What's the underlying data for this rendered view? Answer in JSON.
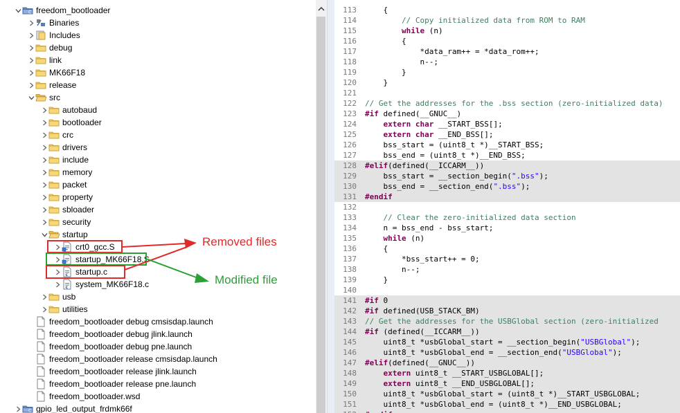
{
  "project_explorer": {
    "items": [
      {
        "label": "freedom_bootloader",
        "icon": "project-folder-icon",
        "indent": 0,
        "twisty": "expanded"
      },
      {
        "label": "Binaries",
        "icon": "binaries-icon",
        "indent": 1,
        "twisty": "collapsed"
      },
      {
        "label": "Includes",
        "icon": "includes-icon",
        "indent": 1,
        "twisty": "collapsed"
      },
      {
        "label": "debug",
        "icon": "folder-icon",
        "indent": 1,
        "twisty": "collapsed"
      },
      {
        "label": "link",
        "icon": "folder-icon",
        "indent": 1,
        "twisty": "collapsed"
      },
      {
        "label": "MK66F18",
        "icon": "folder-icon",
        "indent": 1,
        "twisty": "collapsed"
      },
      {
        "label": "release",
        "icon": "folder-icon",
        "indent": 1,
        "twisty": "collapsed"
      },
      {
        "label": "src",
        "icon": "folder-open-icon",
        "indent": 1,
        "twisty": "expanded"
      },
      {
        "label": "autobaud",
        "icon": "folder-icon",
        "indent": 2,
        "twisty": "collapsed"
      },
      {
        "label": "bootloader",
        "icon": "folder-icon",
        "indent": 2,
        "twisty": "collapsed"
      },
      {
        "label": "crc",
        "icon": "folder-icon",
        "indent": 2,
        "twisty": "collapsed"
      },
      {
        "label": "drivers",
        "icon": "folder-icon",
        "indent": 2,
        "twisty": "collapsed"
      },
      {
        "label": "include",
        "icon": "folder-icon",
        "indent": 2,
        "twisty": "collapsed"
      },
      {
        "label": "memory",
        "icon": "folder-icon",
        "indent": 2,
        "twisty": "collapsed"
      },
      {
        "label": "packet",
        "icon": "folder-icon",
        "indent": 2,
        "twisty": "collapsed"
      },
      {
        "label": "property",
        "icon": "folder-icon",
        "indent": 2,
        "twisty": "collapsed"
      },
      {
        "label": "sbloader",
        "icon": "folder-icon",
        "indent": 2,
        "twisty": "collapsed"
      },
      {
        "label": "security",
        "icon": "folder-icon",
        "indent": 2,
        "twisty": "collapsed"
      },
      {
        "label": "startup",
        "icon": "folder-open-icon",
        "indent": 2,
        "twisty": "expanded"
      },
      {
        "label": "crt0_gcc.S",
        "icon": "source-file-icon",
        "indent": 3,
        "twisty": "collapsed"
      },
      {
        "label": "startup_MK66F18.S",
        "icon": "source-file-icon",
        "indent": 3,
        "twisty": "collapsed"
      },
      {
        "label": "startup.c",
        "icon": "c-file-icon",
        "indent": 3,
        "twisty": "collapsed"
      },
      {
        "label": "system_MK66F18.c",
        "icon": "c-file-icon",
        "indent": 3,
        "twisty": "collapsed"
      },
      {
        "label": "usb",
        "icon": "folder-icon",
        "indent": 2,
        "twisty": "collapsed"
      },
      {
        "label": "utilities",
        "icon": "folder-icon",
        "indent": 2,
        "twisty": "collapsed"
      },
      {
        "label": "freedom_bootloader debug cmsisdap.launch",
        "icon": "launch-file-icon",
        "indent": 1,
        "twisty": "none"
      },
      {
        "label": "freedom_bootloader debug jlink.launch",
        "icon": "launch-file-icon",
        "indent": 1,
        "twisty": "none"
      },
      {
        "label": "freedom_bootloader debug pne.launch",
        "icon": "launch-file-icon",
        "indent": 1,
        "twisty": "none"
      },
      {
        "label": "freedom_bootloader release cmsisdap.launch",
        "icon": "launch-file-icon",
        "indent": 1,
        "twisty": "none"
      },
      {
        "label": "freedom_bootloader release jlink.launch",
        "icon": "launch-file-icon",
        "indent": 1,
        "twisty": "none"
      },
      {
        "label": "freedom_bootloader release pne.launch",
        "icon": "launch-file-icon",
        "indent": 1,
        "twisty": "none"
      },
      {
        "label": "freedom_bootloader.wsd",
        "icon": "launch-file-icon",
        "indent": 1,
        "twisty": "none"
      },
      {
        "label": "gpio_led_output_frdmk66f",
        "icon": "project-folder-icon",
        "indent": 0,
        "twisty": "collapsed"
      }
    ]
  },
  "annotations": {
    "removed_label": "Removed files",
    "modified_label": "Modified file",
    "removed_color": "#e02b2b",
    "modified_color": "#2aa035"
  },
  "editor": {
    "lines": [
      {
        "n": "113",
        "hl": false,
        "code": "    {"
      },
      {
        "n": "114",
        "hl": false,
        "code": "        // Copy initialized data from ROM to RAM"
      },
      {
        "n": "115",
        "hl": false,
        "code": "        while (n)"
      },
      {
        "n": "116",
        "hl": false,
        "code": "        {"
      },
      {
        "n": "117",
        "hl": false,
        "code": "            *data_ram++ = *data_rom++;"
      },
      {
        "n": "118",
        "hl": false,
        "code": "            n--;"
      },
      {
        "n": "119",
        "hl": false,
        "code": "        }"
      },
      {
        "n": "120",
        "hl": false,
        "code": "    }"
      },
      {
        "n": "121",
        "hl": false,
        "code": ""
      },
      {
        "n": "122",
        "hl": false,
        "code": "// Get the addresses for the .bss section (zero-initialized data)"
      },
      {
        "n": "123",
        "hl": false,
        "code": "#if defined(__GNUC__)"
      },
      {
        "n": "124",
        "hl": false,
        "code": "    extern char __START_BSS[];"
      },
      {
        "n": "125",
        "hl": false,
        "code": "    extern char __END_BSS[];"
      },
      {
        "n": "126",
        "hl": false,
        "code": "    bss_start = (uint8_t *)__START_BSS;"
      },
      {
        "n": "127",
        "hl": false,
        "code": "    bss_end = (uint8_t *)__END_BSS;"
      },
      {
        "n": "128",
        "hl": true,
        "code": "#elif(defined(__ICCARM__))"
      },
      {
        "n": "129",
        "hl": true,
        "code": "    bss_start = __section_begin(\".bss\");"
      },
      {
        "n": "130",
        "hl": true,
        "code": "    bss_end = __section_end(\".bss\");"
      },
      {
        "n": "131",
        "hl": true,
        "code": "#endif"
      },
      {
        "n": "132",
        "hl": false,
        "code": ""
      },
      {
        "n": "133",
        "hl": false,
        "code": "    // Clear the zero-initialized data section"
      },
      {
        "n": "134",
        "hl": false,
        "code": "    n = bss_end - bss_start;"
      },
      {
        "n": "135",
        "hl": false,
        "code": "    while (n)"
      },
      {
        "n": "136",
        "hl": false,
        "code": "    {"
      },
      {
        "n": "137",
        "hl": false,
        "code": "        *bss_start++ = 0;"
      },
      {
        "n": "138",
        "hl": false,
        "code": "        n--;"
      },
      {
        "n": "139",
        "hl": false,
        "code": "    }"
      },
      {
        "n": "140",
        "hl": false,
        "code": ""
      },
      {
        "n": "141",
        "hl": true,
        "code": "#if 0"
      },
      {
        "n": "142",
        "hl": true,
        "code": "#if defined(USB_STACK_BM)"
      },
      {
        "n": "143",
        "hl": true,
        "code": "// Get the addresses for the USBGlobal section (zero-initialized"
      },
      {
        "n": "144",
        "hl": true,
        "code": "#if (defined(__ICCARM__))"
      },
      {
        "n": "145",
        "hl": true,
        "code": "    uint8_t *usbGlobal_start = __section_begin(\"USBGlobal\");"
      },
      {
        "n": "146",
        "hl": true,
        "code": "    uint8_t *usbGlobal_end = __section_end(\"USBGlobal\");"
      },
      {
        "n": "147",
        "hl": true,
        "code": "#elif(defined(__GNUC__))"
      },
      {
        "n": "148",
        "hl": true,
        "code": "    extern uint8_t __START_USBGLOBAL[];"
      },
      {
        "n": "149",
        "hl": true,
        "code": "    extern uint8_t __END_USBGLOBAL[];"
      },
      {
        "n": "150",
        "hl": true,
        "code": "    uint8_t *usbGlobal_start = (uint8_t *)__START_USBGLOBAL;"
      },
      {
        "n": "151",
        "hl": true,
        "code": "    uint8_t *usbGlobal_end = (uint8_t *)__END_USBGLOBAL;"
      },
      {
        "n": "152",
        "hl": true,
        "code": "#endif"
      }
    ]
  }
}
